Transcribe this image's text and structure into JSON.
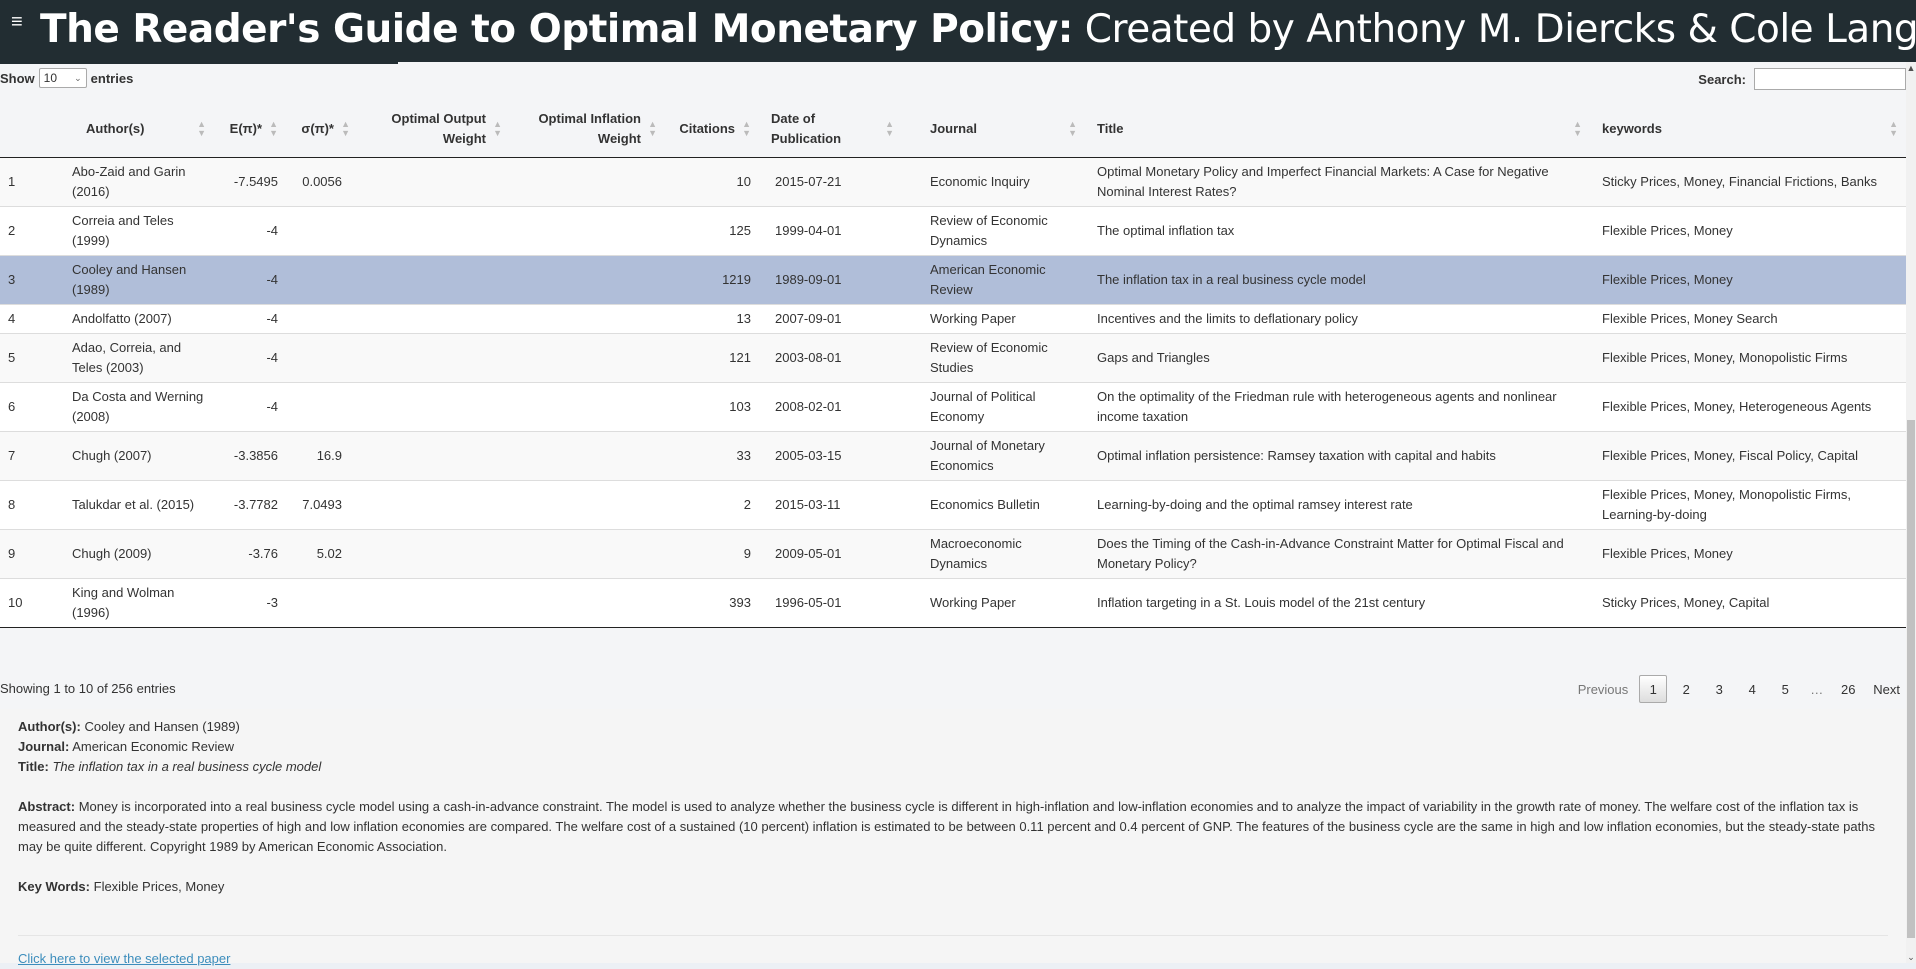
{
  "header": {
    "menu_icon": "hamburger-icon",
    "title_bold": "The Reader's Guide to Optimal Monetary Policy:",
    "title_rest": " Created by Anthony M. Diercks & Cole Langlois",
    "background": "#222d32"
  },
  "controls": {
    "show_label": "Show",
    "entries_value": "10",
    "entries_label": "entries",
    "search_label": "Search:",
    "search_value": ""
  },
  "table": {
    "columns": [
      "",
      "Author(s)",
      "E(π)*",
      "σ(π)*",
      "Optimal Output Weight",
      "Optimal Inflation Weight",
      "Citations",
      "Date of Publication",
      "Journal",
      "Title",
      "keywords"
    ],
    "rows": [
      {
        "n": "1",
        "author": "Abo-Zaid and Garin (2016)",
        "e": "-7.5495",
        "s": "0.0056",
        "ow": "",
        "iw": "",
        "cit": "10",
        "date": "2015-07-21",
        "journal": "Economic Inquiry",
        "title": "Optimal Monetary Policy and Imperfect Financial Markets: A Case for Negative Nominal Interest Rates?",
        "kw": "Sticky Prices, Money, Financial Frictions, Banks"
      },
      {
        "n": "2",
        "author": "Correia and Teles (1999)",
        "e": "-4",
        "s": "",
        "ow": "",
        "iw": "",
        "cit": "125",
        "date": "1999-04-01",
        "journal": "Review of Economic Dynamics",
        "title": "The optimal inflation tax",
        "kw": "Flexible Prices, Money"
      },
      {
        "n": "3",
        "author": "Cooley and Hansen (1989)",
        "e": "-4",
        "s": "",
        "ow": "",
        "iw": "",
        "cit": "1219",
        "date": "1989-09-01",
        "journal": "American Economic Review",
        "title": "The inflation tax in a real business cycle model",
        "kw": "Flexible Prices, Money"
      },
      {
        "n": "4",
        "author": "Andolfatto (2007)",
        "e": "-4",
        "s": "",
        "ow": "",
        "iw": "",
        "cit": "13",
        "date": "2007-09-01",
        "journal": "Working Paper",
        "title": "Incentives and the limits to deflationary policy",
        "kw": "Flexible Prices, Money Search"
      },
      {
        "n": "5",
        "author": "Adao, Correia, and Teles (2003)",
        "e": "-4",
        "s": "",
        "ow": "",
        "iw": "",
        "cit": "121",
        "date": "2003-08-01",
        "journal": "Review of Economic Studies",
        "title": "Gaps and Triangles",
        "kw": "Flexible Prices, Money, Monopolistic Firms"
      },
      {
        "n": "6",
        "author": "Da Costa and Werning (2008)",
        "e": "-4",
        "s": "",
        "ow": "",
        "iw": "",
        "cit": "103",
        "date": "2008-02-01",
        "journal": "Journal of Political Economy",
        "title": "On the optimality of the Friedman rule with heterogeneous agents and nonlinear income taxation",
        "kw": "Flexible Prices, Money, Heterogeneous Agents"
      },
      {
        "n": "7",
        "author": "Chugh (2007)",
        "e": "-3.3856",
        "s": "16.9",
        "ow": "",
        "iw": "",
        "cit": "33",
        "date": "2005-03-15",
        "journal": "Journal of Monetary Economics",
        "title": "Optimal inflation persistence: Ramsey taxation with capital and habits",
        "kw": "Flexible Prices, Money, Fiscal Policy, Capital"
      },
      {
        "n": "8",
        "author": "Talukdar et al. (2015)",
        "e": "-3.7782",
        "s": "7.0493",
        "ow": "",
        "iw": "",
        "cit": "2",
        "date": "2015-03-11",
        "journal": "Economics Bulletin",
        "title": "Learning-by-doing and the optimal ramsey interest rate",
        "kw": "Flexible Prices, Money, Monopolistic Firms, Learning-by-doing"
      },
      {
        "n": "9",
        "author": "Chugh (2009)",
        "e": "-3.76",
        "s": "5.02",
        "ow": "",
        "iw": "",
        "cit": "9",
        "date": "2009-05-01",
        "journal": "Macroeconomic Dynamics",
        "title": "Does the Timing of the Cash-in-Advance Constraint Matter for Optimal Fiscal and Monetary Policy?",
        "kw": "Flexible Prices, Money"
      },
      {
        "n": "10",
        "author": "King and Wolman (1996)",
        "e": "-3",
        "s": "",
        "ow": "",
        "iw": "",
        "cit": "393",
        "date": "1996-05-01",
        "journal": "Working Paper",
        "title": "Inflation targeting in a St. Louis model of the 21st century",
        "kw": "Sticky Prices, Money, Capital"
      }
    ],
    "selected_row": "3"
  },
  "footer": {
    "info": "Showing 1 to 10 of 256 entries",
    "pager": {
      "previous": "Previous",
      "pages": [
        "1",
        "2",
        "3",
        "4",
        "5"
      ],
      "ellipsis": "…",
      "last": "26",
      "next": "Next",
      "current": "1"
    }
  },
  "detail": {
    "author_label": "Author(s):",
    "author": "Cooley and Hansen (1989)",
    "journal_label": "Journal:",
    "journal": "American Economic Review",
    "title_label": "Title:",
    "title": "The inflation tax in a real business cycle model",
    "abstract_label": "Abstract:",
    "abstract": "Money is incorporated into a real business cycle model using a cash-in-advance constraint. The model is used to analyze whether the business cycle is different in high-inflation and low-inflation economies and to analyze the impact of variability in the growth rate of money. The welfare cost of the inflation tax is measured and the steady-state properties of high and low inflation economies are compared. The welfare cost of a sustained (10 percent) inflation is estimated to be between 0.11 percent and 0.4 percent of GNP. The features of the business cycle are the same in high and low inflation economies, but the steady-state paths may be quite different. Copyright 1989 by American Economic Association.",
    "keywords_label": "Key Words:",
    "keywords": "Flexible Prices, Money",
    "link": "Click here to view the selected paper"
  },
  "colors": {
    "selected_row": "#b0bed9",
    "link": "#3c8dbc"
  }
}
